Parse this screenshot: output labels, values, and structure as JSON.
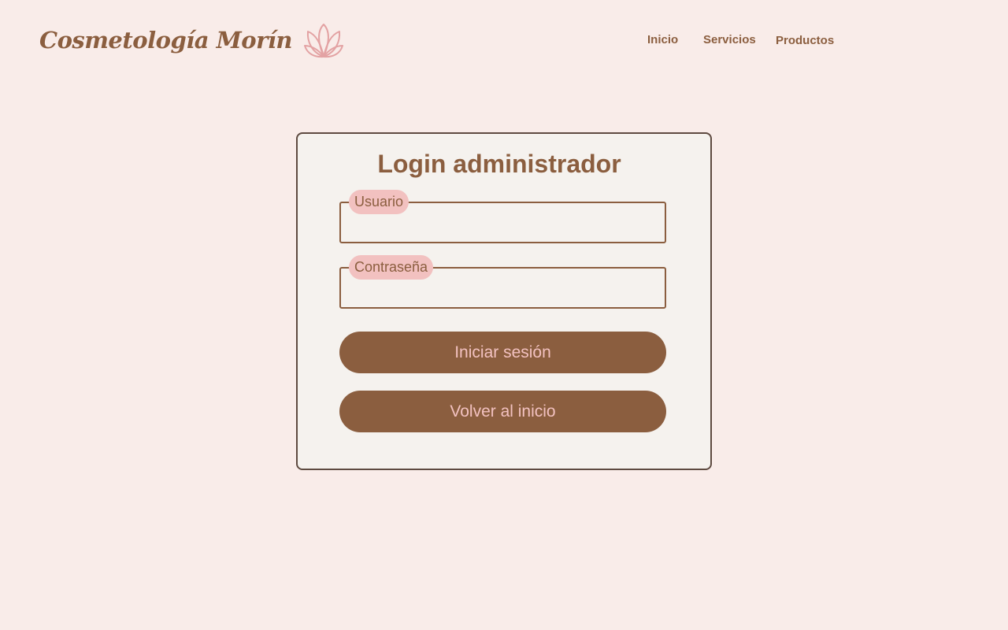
{
  "brand": {
    "name": "Cosmetología Morín",
    "logo_icon": "lotus-icon",
    "colors": {
      "primary": "#8b5e3f",
      "accent": "#f2c1c0",
      "background": "#f9ece9",
      "card": "#f5f2ee"
    }
  },
  "nav": {
    "items": [
      {
        "label": "Inicio"
      },
      {
        "label": "Servicios"
      },
      {
        "label": "Productos"
      }
    ]
  },
  "login": {
    "title": "Login administrador",
    "username": {
      "label": "Usuario",
      "value": ""
    },
    "password": {
      "label": "Contraseña",
      "value": ""
    },
    "submit_label": "Iniciar sesión",
    "back_label": "Volver al inicio"
  }
}
